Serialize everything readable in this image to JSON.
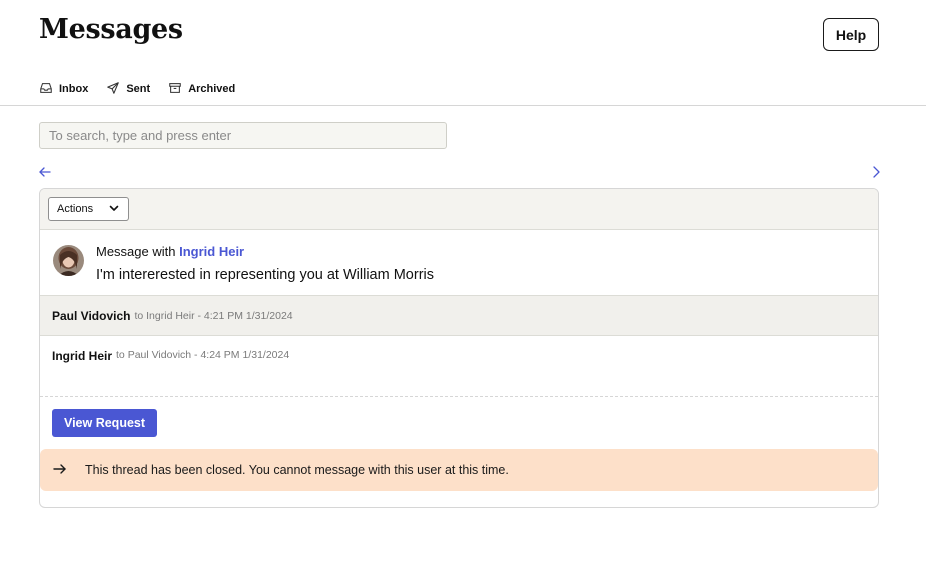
{
  "header": {
    "title": "Messages",
    "help_label": "Help"
  },
  "tabs": [
    {
      "label": "Inbox",
      "icon": "inbox-icon"
    },
    {
      "label": "Sent",
      "icon": "send-icon"
    },
    {
      "label": "Archived",
      "icon": "archive-icon"
    }
  ],
  "search": {
    "placeholder": "To search, type and press enter",
    "value": ""
  },
  "thread": {
    "actions_label": "Actions",
    "message_with_prefix": "Message with",
    "participant": "Ingrid Heir",
    "subject": "I'm intererested in representing you at William Morris",
    "messages": [
      {
        "sender": "Paul Vidovich",
        "meta": "to Ingrid Heir - 4:21 PM 1/31/2024"
      },
      {
        "sender": "Ingrid Heir",
        "meta": "to Paul Vidovich - 4:24 PM 1/31/2024"
      }
    ],
    "view_request_label": "View Request",
    "closed_notice": "This thread has been closed. You cannot message with this user at this time."
  },
  "colors": {
    "accent": "#4a57d3",
    "notice_bg": "#fde0c9",
    "toolbar_bg": "#f4f3ef"
  }
}
